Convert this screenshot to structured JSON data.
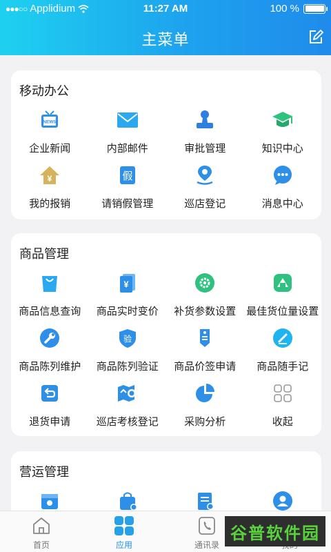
{
  "status_bar": {
    "carrier": "Applidium",
    "time": "11:27 AM",
    "battery": "100 %"
  },
  "header": {
    "title": "主菜单",
    "edit_icon": "edit-icon"
  },
  "sections": [
    {
      "title": "移动办公",
      "items": [
        {
          "label": "企业新闻",
          "icon": "news-tv-icon"
        },
        {
          "label": "内部邮件",
          "icon": "mail-icon"
        },
        {
          "label": "审批管理",
          "icon": "stamp-icon"
        },
        {
          "label": "知识中心",
          "icon": "graduation-cap-icon"
        },
        {
          "label": "我的报销",
          "icon": "reimburse-house-icon"
        },
        {
          "label": "请销假管理",
          "icon": "leave-icon"
        },
        {
          "label": "巡店登记",
          "icon": "location-pin-icon"
        },
        {
          "label": "消息中心",
          "icon": "chat-bubble-icon"
        }
      ]
    },
    {
      "title": "商品管理",
      "items": [
        {
          "label": "商品信息查询",
          "icon": "shopping-bag-icon"
        },
        {
          "label": "商品实时变价",
          "icon": "price-card-icon"
        },
        {
          "label": "补货参数设置",
          "icon": "settings-gear-icon"
        },
        {
          "label": "最佳货位量设置",
          "icon": "warehouse-icon"
        },
        {
          "label": "商品陈列维护",
          "icon": "wrench-icon"
        },
        {
          "label": "商品陈列验证",
          "icon": "verify-shield-icon"
        },
        {
          "label": "商品价签申请",
          "icon": "price-tag-icon"
        },
        {
          "label": "商品随手记",
          "icon": "note-pen-icon"
        },
        {
          "label": "退货申请",
          "icon": "return-icon"
        },
        {
          "label": "巡店考核登记",
          "icon": "map-location-icon"
        },
        {
          "label": "采购分析",
          "icon": "pie-chart-icon"
        },
        {
          "label": "收起",
          "icon": "grid-collapse-icon"
        }
      ]
    },
    {
      "title": "营运管理",
      "items": [
        {
          "label": "",
          "icon": "store-settings-icon"
        },
        {
          "label": "",
          "icon": "bag-check-icon"
        },
        {
          "label": "",
          "icon": "report-icon"
        },
        {
          "label": "",
          "icon": "user-icon"
        }
      ]
    }
  ],
  "tabs": [
    {
      "label": "首页",
      "icon": "home-icon"
    },
    {
      "label": "应用",
      "icon": "apps-icon"
    },
    {
      "label": "通讯录",
      "icon": "phone-book-icon"
    },
    {
      "label": "我的",
      "icon": "user-icon"
    }
  ],
  "watermark": "谷普软件园",
  "colors": {
    "header_start": "#1ed1f0",
    "header_end": "#1f8bec",
    "accent": "#1e90ee",
    "active_tab": "#1e90ee",
    "icon_green": "#2ec27e",
    "icon_gold": "#d7b25c"
  }
}
